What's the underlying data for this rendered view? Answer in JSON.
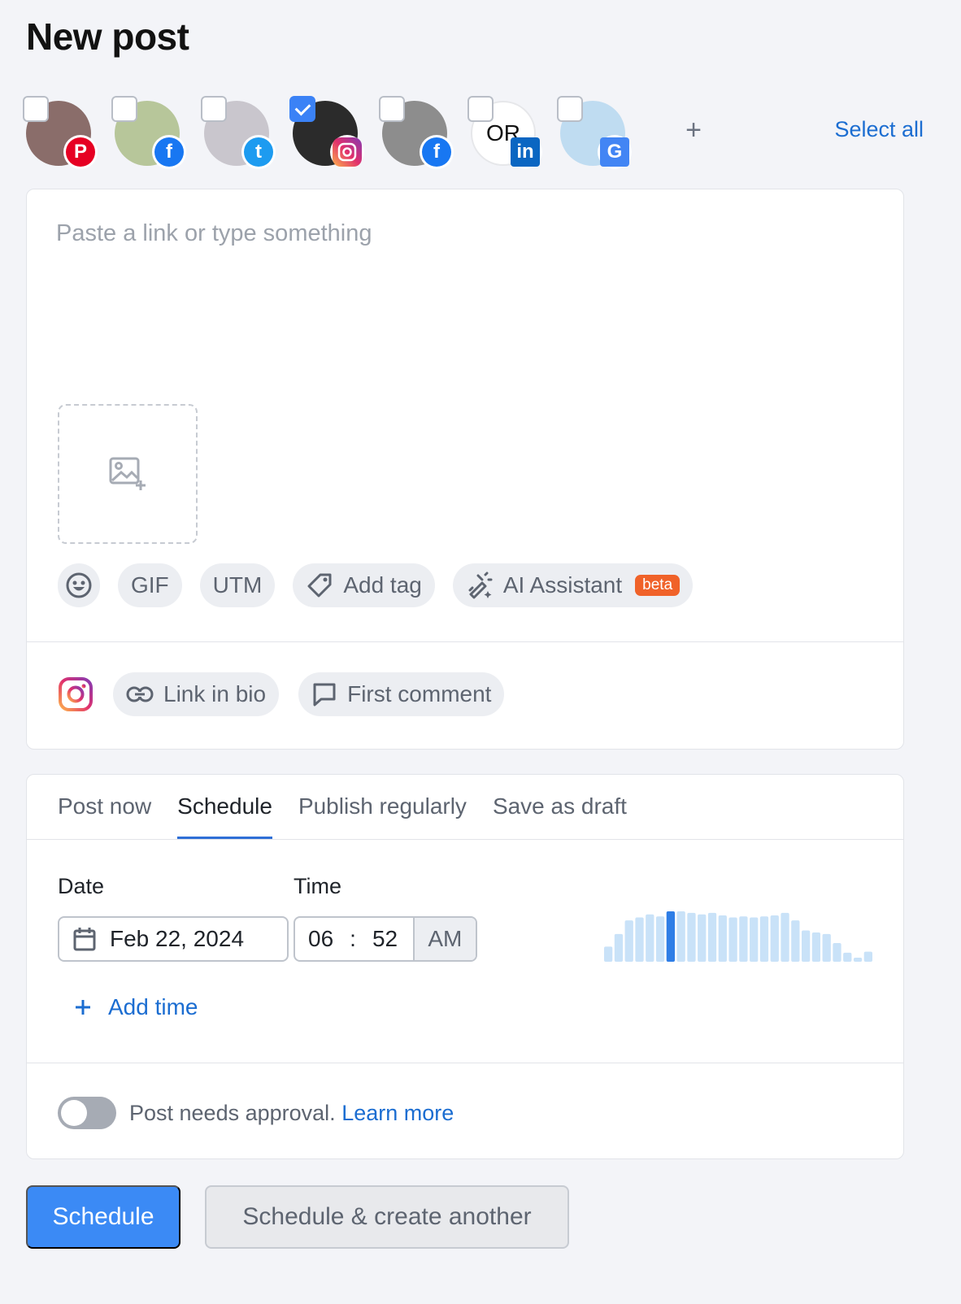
{
  "page": {
    "title": "New post"
  },
  "accounts": {
    "items": [
      {
        "network": "pinterest",
        "checked": false,
        "network_color": "#e60023",
        "avatar_color": "#8a6d6a"
      },
      {
        "network": "facebook",
        "checked": false,
        "network_color": "#1877f2",
        "avatar_color": "#b7c69a"
      },
      {
        "network": "twitter",
        "checked": false,
        "network_color": "#1d9bf0",
        "avatar_color": "#c9c6cd"
      },
      {
        "network": "instagram",
        "checked": true,
        "network_color": "#d62976",
        "avatar_color": "#2b2b2b"
      },
      {
        "network": "facebook",
        "checked": false,
        "network_color": "#1877f2",
        "avatar_color": "#8d8d8d"
      },
      {
        "network": "linkedin",
        "checked": false,
        "network_color": "#0a66c2",
        "avatar_color": "#ffffff",
        "avatar_text": "OR"
      },
      {
        "network": "google-business",
        "checked": false,
        "network_color": "#4285f4",
        "avatar_color": "#bfdcf1"
      }
    ],
    "add_label": "+",
    "select_all_label": "Select all"
  },
  "composer": {
    "placeholder": "Paste a link or type something",
    "tools": {
      "gif": "GIF",
      "utm": "UTM",
      "add_tag": "Add tag",
      "ai_assistant": "AI Assistant",
      "beta": "beta"
    },
    "instagram": {
      "link_in_bio": "Link in bio",
      "first_comment": "First comment"
    }
  },
  "schedule": {
    "tabs": [
      {
        "label": "Post now",
        "active": false
      },
      {
        "label": "Schedule",
        "active": true
      },
      {
        "label": "Publish regularly",
        "active": false
      },
      {
        "label": "Save as draft",
        "active": false
      }
    ],
    "date_label": "Date",
    "time_label": "Time",
    "date_value": "Feb 22, 2024",
    "hour": "06",
    "separator": ":",
    "minute": "52",
    "ampm": "AM",
    "add_time_label": "Add time",
    "approval_text": "Post needs approval.",
    "learn_more": "Learn more",
    "approval_enabled": false,
    "activity": {
      "values": [
        0.3,
        0.55,
        0.82,
        0.88,
        0.94,
        0.9,
        1.0,
        1.0,
        0.97,
        0.94,
        0.97,
        0.92,
        0.88,
        0.9,
        0.88,
        0.9,
        0.92,
        0.97,
        0.82,
        0.62,
        0.58,
        0.55,
        0.37,
        0.18,
        0.08,
        0.2
      ],
      "highlight_index": 6,
      "bar_color": "#c9e2f8",
      "highlight_color": "#2f7ee6"
    }
  },
  "actions": {
    "primary": "Schedule",
    "secondary": "Schedule & create another"
  }
}
